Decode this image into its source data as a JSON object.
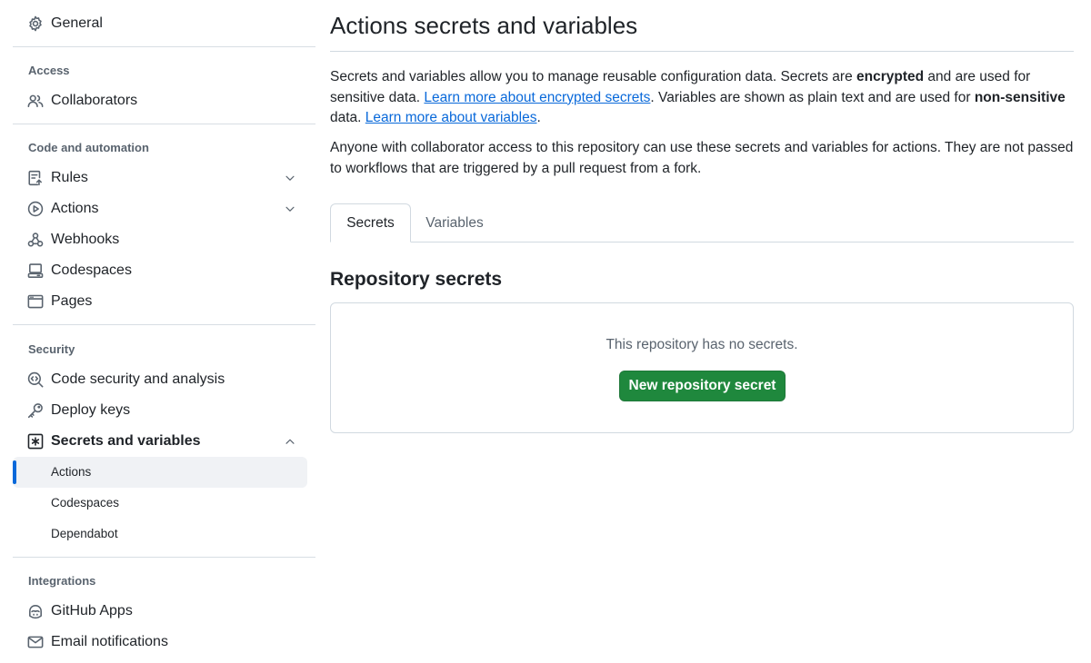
{
  "sidebar": {
    "top_items": [
      {
        "label": "General",
        "icon": "gear-icon"
      }
    ],
    "sections": {
      "access": {
        "heading": "Access",
        "items": [
          {
            "label": "Collaborators",
            "icon": "people-icon"
          }
        ]
      },
      "code_automation": {
        "heading": "Code and automation",
        "items": [
          {
            "label": "Rules",
            "icon": "rules-icon",
            "expandable": true
          },
          {
            "label": "Actions",
            "icon": "play-icon",
            "expandable": true
          },
          {
            "label": "Webhooks",
            "icon": "webhook-icon"
          },
          {
            "label": "Codespaces",
            "icon": "codespaces-icon"
          },
          {
            "label": "Pages",
            "icon": "browser-icon"
          }
        ]
      },
      "security": {
        "heading": "Security",
        "items": [
          {
            "label": "Code security and analysis",
            "icon": "codescan-icon"
          },
          {
            "label": "Deploy keys",
            "icon": "key-icon"
          },
          {
            "label": "Secrets and variables",
            "icon": "asterisk-box-icon",
            "expanded": true
          }
        ],
        "subitems": [
          {
            "label": "Actions",
            "active": true
          },
          {
            "label": "Codespaces"
          },
          {
            "label": "Dependabot"
          }
        ]
      },
      "integrations": {
        "heading": "Integrations",
        "items": [
          {
            "label": "GitHub Apps",
            "icon": "copilot-app-icon"
          },
          {
            "label": "Email notifications",
            "icon": "mail-icon"
          }
        ]
      }
    }
  },
  "main": {
    "title": "Actions secrets and variables",
    "intro": {
      "p1_a": "Secrets and variables allow you to manage reusable configuration data. Secrets are ",
      "p1_b": "encrypted",
      "p1_c": " and are used for sensitive data. ",
      "p1_link1": "Learn more about encrypted secrets",
      "p1_d": ". Variables are shown as plain text and are used for ",
      "p1_e": "non-sensitive",
      "p1_f": " data. ",
      "p1_link2": "Learn more about variables",
      "p1_g": ".",
      "p2": "Anyone with collaborator access to this repository can use these secrets and variables for actions. They are not passed to workflows that are triggered by a pull request from a fork."
    },
    "tabs": [
      {
        "label": "Secrets",
        "selected": true
      },
      {
        "label": "Variables"
      }
    ],
    "section_title": "Repository secrets",
    "empty_message": "This repository has no secrets.",
    "new_button_label": "New repository secret"
  },
  "colors": {
    "accent": "#0969da",
    "primary_button": "#1f883d",
    "muted_text": "#59636e",
    "border": "#d1d9e0"
  }
}
